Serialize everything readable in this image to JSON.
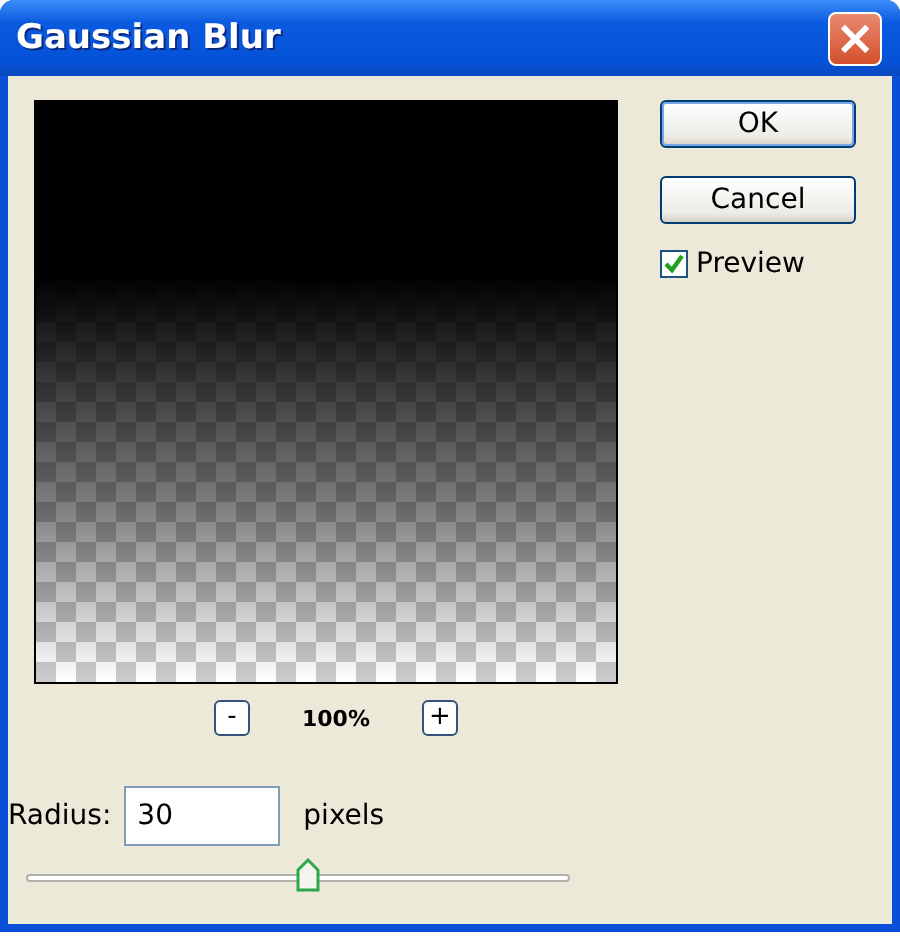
{
  "window": {
    "title": "Gaussian Blur",
    "close": "×"
  },
  "zoom": {
    "minus": "-",
    "value": "100%",
    "plus": "+"
  },
  "buttons": [
    {
      "label": "OK",
      "default": true
    },
    {
      "label": "Cancel",
      "default": false
    }
  ],
  "preview_option": {
    "label": "Preview",
    "checked": true
  },
  "radius": {
    "label": "Radius:",
    "value": "30",
    "unit": "pixels",
    "level": 0.52
  }
}
